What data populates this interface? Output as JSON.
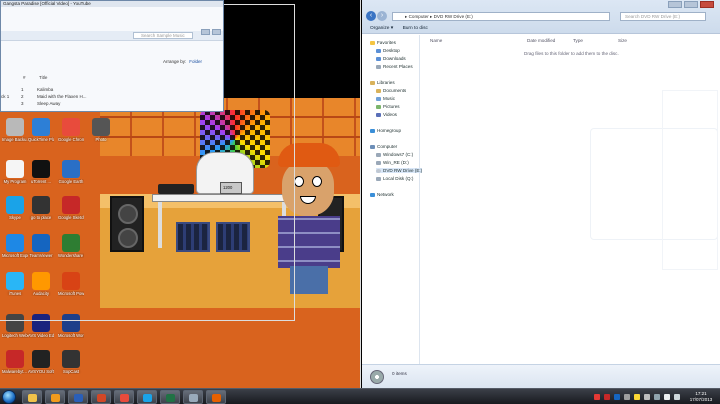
{
  "left_window": {
    "title": "Gangsta Paradise [Official Video] - YouTube",
    "search_placeholder": "Search Sample Music",
    "arrange_label": "Arrange by:",
    "arrange_value": "Folder",
    "col_num": "#",
    "col_title": "Title",
    "tracks": [
      {
        "num": "1",
        "title": "Kalimba"
      },
      {
        "num": "2",
        "title": "Maid with the Flaxen H..."
      },
      {
        "num": "3",
        "title": "Sleep Away"
      }
    ],
    "side_frag": "ck 1"
  },
  "desktop_icons": [
    {
      "label": "Image Backu...",
      "color": "#b9b9b9"
    },
    {
      "label": "QuickTime Player",
      "color": "#2d7fd6"
    },
    {
      "label": "Google Chrome",
      "color": "#e84b3c"
    },
    {
      "label": "Photo",
      "color": "#555"
    },
    {
      "label": "My Program",
      "color": "#f5f5f5"
    },
    {
      "label": "uTorrent ...",
      "color": "#111"
    },
    {
      "label": "Google Earth",
      "color": "#2a6fc6"
    },
    {
      "label": "Skype",
      "color": "#1aa3e8"
    },
    {
      "label": "go to place",
      "color": "#333"
    },
    {
      "label": "Google SketchUp 8",
      "color": "#c62828"
    },
    {
      "label": "Microsoft Expression E...",
      "color": "#1e88e5"
    },
    {
      "label": "TeamViewer",
      "color": "#1565c0"
    },
    {
      "label": "Wondershare Player",
      "color": "#2e7d32"
    },
    {
      "label": "iTunes",
      "color": "#29b6f6"
    },
    {
      "label": "Audacity",
      "color": "#ff9800"
    },
    {
      "label": "Microsoft PowerPoi...",
      "color": "#d84315"
    },
    {
      "label": "Logitech Webca...",
      "color": "#444"
    },
    {
      "label": "AVS Video Editor",
      "color": "#1a237e"
    },
    {
      "label": "Microsoft Word 2010",
      "color": "#1e3f8a"
    },
    {
      "label": "Malwarebyt... Anti-Malware",
      "color": "#c62828"
    },
    {
      "label": "AVSYOU Softwar...",
      "color": "#222"
    },
    {
      "label": "SopCast",
      "color": "#333"
    }
  ],
  "scene": {
    "mixer_label": "1200"
  },
  "right_window": {
    "address": "▸ Computer ▸ DVD RW Drive (E:)",
    "search_placeholder": "Search DVD RW Drive (E:)",
    "toolbar": [
      "Organize ▾",
      "Burn to disc"
    ],
    "nav": {
      "favorites": "Favorites",
      "favorites_items": [
        "Desktop",
        "Downloads",
        "Recent Places"
      ],
      "libraries": "Libraries",
      "libraries_items": [
        "Documents",
        "Music",
        "Pictures",
        "Videos"
      ],
      "homegroup": "Homegroup",
      "computer": "Computer",
      "computer_items": [
        "Windows7 (C:)",
        "Win_RE (D:)",
        "DVD RW Drive (E:)",
        "Local Disk (Q:)"
      ],
      "network": "Network"
    },
    "columns": {
      "name": "Name",
      "date": "Date modified",
      "type": "Type",
      "size": "Size"
    },
    "empty_message": "Drag files to this folder to add them to the disc.",
    "status": "0 items"
  },
  "taskbar": {
    "time": "17:21",
    "date": "17/07/2013",
    "apps": [
      {
        "name": "explorer",
        "color": "#f0c24a"
      },
      {
        "name": "media-player",
        "color": "#f29b1d"
      },
      {
        "name": "word",
        "color": "#2a5fb8"
      },
      {
        "name": "powerpoint",
        "color": "#d24726"
      },
      {
        "name": "chrome",
        "color": "#e84b3c"
      },
      {
        "name": "skype",
        "color": "#1aa3e8"
      },
      {
        "name": "excel",
        "color": "#207245"
      },
      {
        "name": "notepad",
        "color": "#9ab"
      },
      {
        "name": "firefox",
        "color": "#e66000"
      }
    ]
  }
}
